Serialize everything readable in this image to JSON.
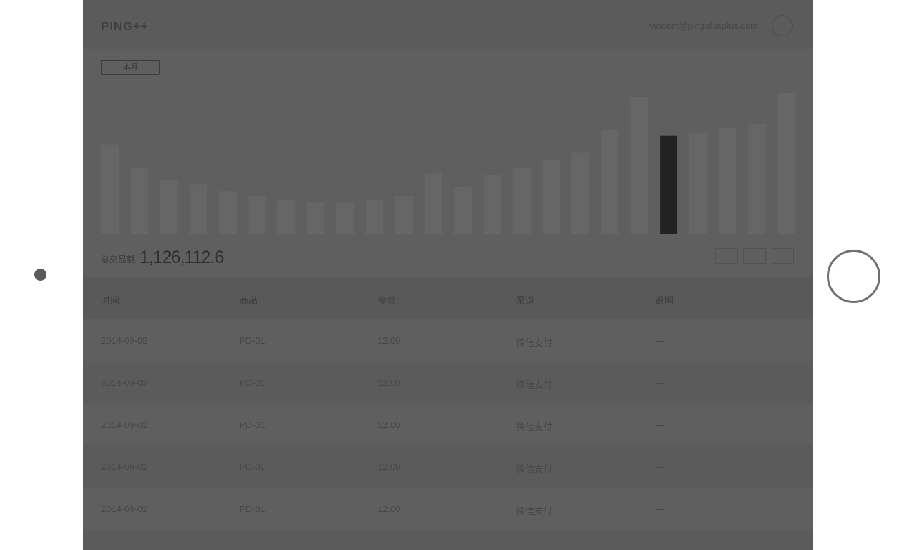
{
  "app": {
    "logo": "PING++",
    "user_email": "vincent@pingplusplus.com"
  },
  "period_button": "本月",
  "chart_data": {
    "type": "bar",
    "highlight_index": 19,
    "values": [
      128,
      94,
      76,
      71,
      61,
      53,
      48,
      45,
      45,
      48,
      54,
      86,
      67,
      84,
      95,
      106,
      116,
      148,
      196,
      140,
      145,
      151,
      157,
      201
    ],
    "highlight_color": "#222222",
    "bar_color": "#666666"
  },
  "stats": {
    "label": "总交易额",
    "value": "1,126,112.6"
  },
  "table": {
    "headers": [
      "时间",
      "商品",
      "金额",
      "渠道",
      "说明"
    ],
    "rows": [
      [
        "2014-09-02",
        "PD-01",
        "12.00",
        "微信支付",
        "—"
      ],
      [
        "2014-09-02",
        "PD-01",
        "12.00",
        "微信支付",
        "—"
      ],
      [
        "2014-09-02",
        "PD-01",
        "12.00",
        "微信支付",
        "—"
      ],
      [
        "2014-09-02",
        "PD-01",
        "12.00",
        "微信支付",
        "—"
      ],
      [
        "2014-09-02",
        "PD-01",
        "12.00",
        "微信支付",
        "—"
      ]
    ]
  }
}
